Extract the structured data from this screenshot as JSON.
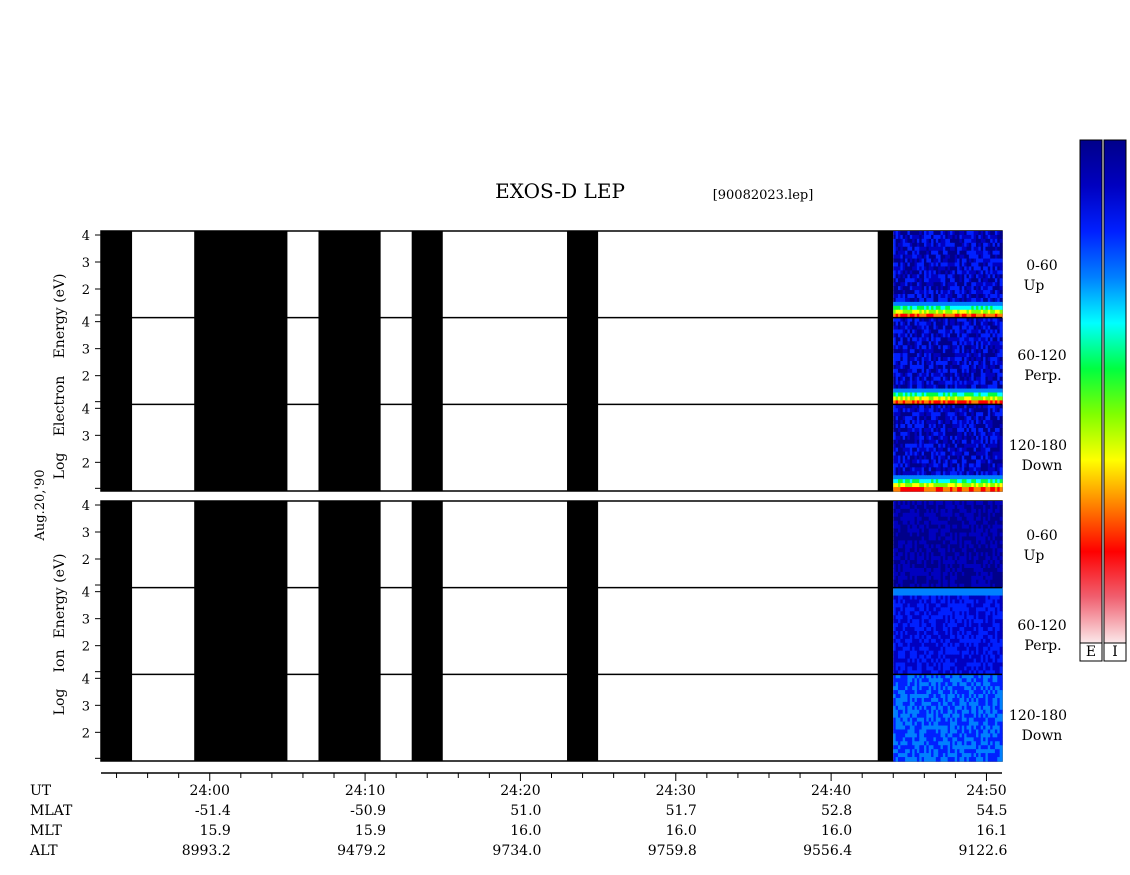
{
  "title": "EXOS-D LEP",
  "filename": "[90082023.lep]",
  "date_label": "Aug.20,'90",
  "panels": [
    {
      "id": "electron",
      "ylabel": [
        "Log",
        "Electron",
        "Energy (eV)"
      ]
    },
    {
      "id": "ion",
      "ylabel": [
        "Log",
        "Ion",
        "Energy (eV)"
      ]
    }
  ],
  "pitch_bands": [
    {
      "angle": "0-60",
      "dir": "Up"
    },
    {
      "angle": "60-120",
      "dir": "Perp."
    },
    {
      "angle": "120-180",
      "dir": "Down"
    }
  ],
  "colorbars": [
    {
      "label": "E"
    },
    {
      "label": "I"
    }
  ],
  "chart_data": {
    "type": "heatmap",
    "title": "EXOS-D LEP",
    "x_unit": "UT",
    "x_range": [
      "23:53",
      "24:51"
    ],
    "y_scale": "log",
    "y_ticks": [
      "2",
      "3",
      "4"
    ],
    "no_data_intervals": [
      [
        "23:53",
        "23:55"
      ],
      [
        "23:59",
        "24:05"
      ],
      [
        "24:07",
        "24:11"
      ],
      [
        "24:13",
        "24:15"
      ],
      [
        "24:23",
        "24:25"
      ],
      [
        "24:43",
        "24:44"
      ]
    ],
    "data_start": "24:44",
    "electron_bands": {
      "note": "intense low-energy band near log E ~1.5-1.8 in all pitch angle ranges"
    },
    "colorscale": [
      "#fbe8ea",
      "#f06070",
      "#ff0000",
      "#ff8000",
      "#ffff00",
      "#80ff00",
      "#00ff40",
      "#00ffff",
      "#0080ff",
      "#0020ff",
      "#0000c0",
      "#00008a"
    ],
    "ut": [
      "24:00",
      "24:10",
      "24:20",
      "24:30",
      "24:40",
      "24:50"
    ],
    "mlat": [
      "-51.4",
      "-50.9",
      "51.0",
      "51.7",
      "52.8",
      "54.5"
    ],
    "mlt": [
      "15.9",
      "15.9",
      "16.0",
      "16.0",
      "16.0",
      "16.1"
    ],
    "alt": [
      "8993.2",
      "9479.2",
      "9734.0",
      "9759.8",
      "9556.4",
      "9122.6"
    ],
    "row_labels": [
      "UT",
      "MLAT",
      "MLT",
      "ALT"
    ]
  }
}
